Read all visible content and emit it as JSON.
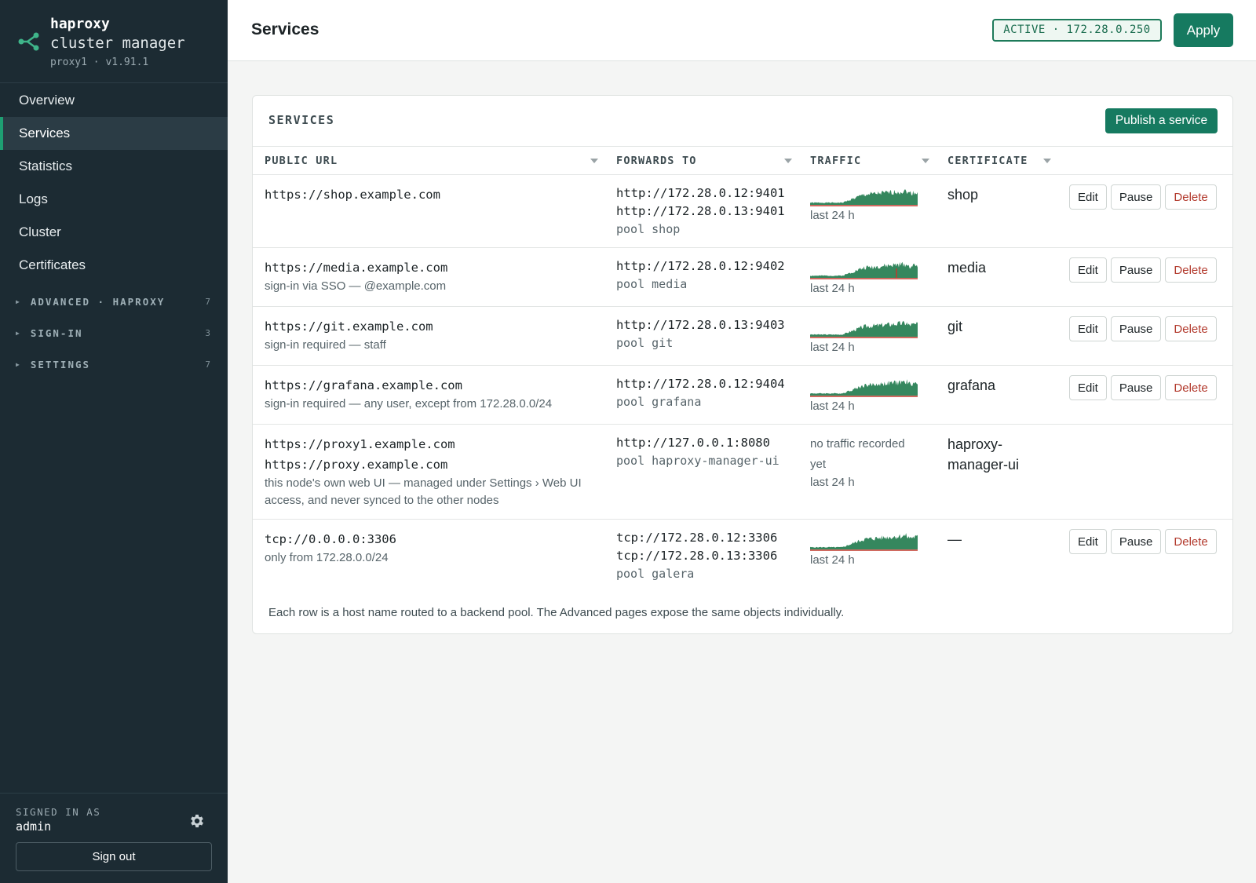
{
  "app": {
    "name": "haproxy",
    "subtitle": "cluster manager",
    "node_version": "proxy1 · v1.91.1"
  },
  "sidebar": {
    "items": [
      {
        "label": "Overview"
      },
      {
        "label": "Services",
        "active": true
      },
      {
        "label": "Statistics"
      },
      {
        "label": "Logs"
      },
      {
        "label": "Cluster"
      },
      {
        "label": "Certificates"
      }
    ],
    "groups": [
      {
        "label": "ADVANCED · HAPROXY",
        "count": "7"
      },
      {
        "label": "SIGN-IN",
        "count": "3"
      },
      {
        "label": "SETTINGS",
        "count": "7"
      }
    ],
    "signed_in_label": "SIGNED IN AS",
    "user": "admin",
    "sign_out": "Sign out"
  },
  "header": {
    "title": "Services",
    "status": "ACTIVE · 172.28.0.250",
    "apply": "Apply"
  },
  "card": {
    "title": "SERVICES",
    "publish": "Publish a service",
    "columns": [
      "PUBLIC URL",
      "FORWARDS TO",
      "TRAFFIC",
      "CERTIFICATE"
    ],
    "footnote": "Each row is a host name routed to a backend pool. The Advanced pages expose the same objects individually."
  },
  "actions": {
    "edit": "Edit",
    "pause": "Pause",
    "delete": "Delete"
  },
  "traffic_label": "last 24 h",
  "no_traffic": "no traffic recorded yet",
  "colors": {
    "accent": "#167a60",
    "sidebar": "#1c2b33",
    "spark": "#1f7a4c",
    "danger": "#b2392c"
  },
  "services": [
    {
      "urls": [
        "https://shop.example.com"
      ],
      "note": "",
      "forwards": [
        "http://172.28.0.12:9401",
        "http://172.28.0.13:9401"
      ],
      "pool": "pool shop",
      "traffic": true,
      "cert": "shop",
      "actions": true
    },
    {
      "urls": [
        "https://media.example.com"
      ],
      "note": "sign-in via SSO — @example.com",
      "forwards": [
        "http://172.28.0.12:9402"
      ],
      "pool": "pool media",
      "traffic": true,
      "cert": "media",
      "actions": true
    },
    {
      "urls": [
        "https://git.example.com"
      ],
      "note": "sign-in required — staff",
      "forwards": [
        "http://172.28.0.13:9403"
      ],
      "pool": "pool git",
      "traffic": true,
      "cert": "git",
      "actions": true
    },
    {
      "urls": [
        "https://grafana.example.com"
      ],
      "note": "sign-in required — any user, except from 172.28.0.0/24",
      "forwards": [
        "http://172.28.0.12:9404"
      ],
      "pool": "pool grafana",
      "traffic": true,
      "cert": "grafana",
      "actions": true
    },
    {
      "urls": [
        "https://proxy1.example.com",
        "https://proxy.example.com"
      ],
      "note": "this node's own web UI — managed under Settings › Web UI access, and never synced to the other nodes",
      "forwards": [
        "http://127.0.0.1:8080"
      ],
      "pool": "pool haproxy-manager-ui",
      "traffic": false,
      "cert": "haproxy-manager-ui",
      "actions": false
    },
    {
      "urls": [
        "tcp://0.0.0.0:3306"
      ],
      "note": "only from 172.28.0.0/24",
      "forwards": [
        "tcp://172.28.0.12:3306",
        "tcp://172.28.0.13:3306"
      ],
      "pool": "pool galera",
      "traffic": true,
      "cert": "—",
      "actions": true
    }
  ]
}
